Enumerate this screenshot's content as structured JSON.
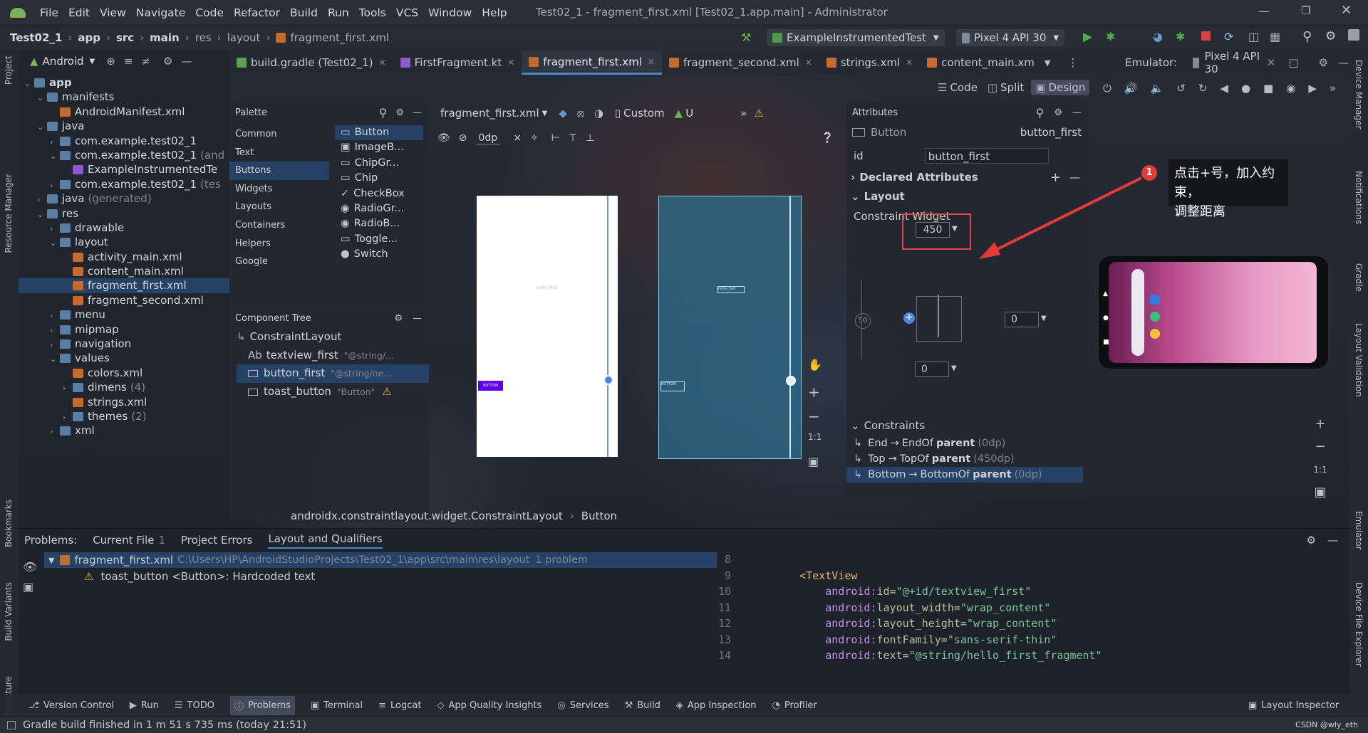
{
  "menu": [
    "File",
    "Edit",
    "View",
    "Navigate",
    "Code",
    "Refactor",
    "Build",
    "Run",
    "Tools",
    "VCS",
    "Window",
    "Help"
  ],
  "window_title": "Test02_1 - fragment_first.xml [Test02_1.app.main] - Administrator",
  "breadcrumb": [
    "Test02_1",
    "app",
    "src",
    "main",
    "res",
    "layout",
    "fragment_first.xml"
  ],
  "run_config": "ExampleInstrumentedTest",
  "device": "Pixel 4 API 30",
  "project_view": "Android",
  "editor_tabs": [
    "build.gradle (Test02_1)",
    "FirstFragment.kt",
    "fragment_first.xml",
    "fragment_second.xml",
    "strings.xml",
    "content_main.xm"
  ],
  "emulator": {
    "label": "Emulator:",
    "device": "Pixel 4 API 30"
  },
  "view_modes": [
    "Code",
    "Split",
    "Design"
  ],
  "tree": [
    {
      "label": "app",
      "depth": 0,
      "arrow": "v",
      "bold": true
    },
    {
      "label": "manifests",
      "depth": 1,
      "arrow": "v"
    },
    {
      "label": "AndroidManifest.xml",
      "depth": 2,
      "arrow": ""
    },
    {
      "label": "java",
      "depth": 1,
      "arrow": "v"
    },
    {
      "label": "com.example.test02_1",
      "depth": 2,
      "arrow": ">"
    },
    {
      "label": "com.example.test02_1",
      "suffix": "(and",
      "depth": 2,
      "arrow": "v"
    },
    {
      "label": "ExampleInstrumentedTe",
      "depth": 3,
      "arrow": ""
    },
    {
      "label": "com.example.test02_1",
      "suffix": "(tes",
      "depth": 2,
      "arrow": ">"
    },
    {
      "label": "java",
      "suffix": "(generated)",
      "depth": 1,
      "arrow": ">"
    },
    {
      "label": "res",
      "depth": 1,
      "arrow": "v"
    },
    {
      "label": "drawable",
      "depth": 2,
      "arrow": ">"
    },
    {
      "label": "layout",
      "depth": 2,
      "arrow": "v"
    },
    {
      "label": "activity_main.xml",
      "depth": 3,
      "arrow": ""
    },
    {
      "label": "content_main.xml",
      "depth": 3,
      "arrow": ""
    },
    {
      "label": "fragment_first.xml",
      "depth": 3,
      "arrow": "",
      "sel": true
    },
    {
      "label": "fragment_second.xml",
      "depth": 3,
      "arrow": ""
    },
    {
      "label": "menu",
      "depth": 2,
      "arrow": ">"
    },
    {
      "label": "mipmap",
      "depth": 2,
      "arrow": ">"
    },
    {
      "label": "navigation",
      "depth": 2,
      "arrow": ">"
    },
    {
      "label": "values",
      "depth": 2,
      "arrow": "v"
    },
    {
      "label": "colors.xml",
      "depth": 3,
      "arrow": ""
    },
    {
      "label": "dimens",
      "suffix": "(4)",
      "depth": 3,
      "arrow": ">"
    },
    {
      "label": "strings.xml",
      "depth": 3,
      "arrow": ""
    },
    {
      "label": "themes",
      "suffix": "(2)",
      "depth": 3,
      "arrow": ">"
    },
    {
      "label": "xml",
      "depth": 2,
      "arrow": ">"
    }
  ],
  "palette": {
    "title": "Palette",
    "categories": [
      "Common",
      "Text",
      "Buttons",
      "Widgets",
      "Layouts",
      "Containers",
      "Helpers",
      "Google"
    ],
    "items": [
      "Button",
      "ImageB...",
      "ChipGr...",
      "Chip",
      "CheckBox",
      "RadioGr...",
      "RadioB...",
      "Toggle...",
      "Switch"
    ]
  },
  "component_tree": {
    "title": "Component Tree",
    "root": "ConstraintLayout",
    "children": [
      {
        "label": "textview_first",
        "hint": "\"@string/...",
        "prefix": "Ab"
      },
      {
        "label": "button_first",
        "hint": "\"@string/ne...",
        "sel": true
      },
      {
        "label": "toast_button",
        "hint": "\"Button\""
      }
    ]
  },
  "design_toolbar": {
    "file": "fragment_first.xml",
    "device": "Custom",
    "api": "U",
    "margin": "0dp"
  },
  "design_breadcrumb": [
    "androidx.constraintlayout.widget.ConstraintLayout",
    "Button"
  ],
  "attributes": {
    "title": "Attributes",
    "widget_type": "Button",
    "widget_id": "button_first",
    "id_label": "id",
    "id_value": "button_first",
    "declared": "Declared Attributes",
    "layout": "Layout",
    "constraint_widget": "Constraint Widget",
    "top_margin": "450",
    "right_margin": "0",
    "bottom_margin": "0",
    "left_bias": "50",
    "constraints_title": "Constraints",
    "constraints": [
      {
        "a": "End",
        "b": "EndOf",
        "c": "parent",
        "d": "(0dp)"
      },
      {
        "a": "Top",
        "b": "TopOf",
        "c": "parent",
        "d": "(450dp)"
      },
      {
        "a": "Bottom",
        "b": "BottomOf",
        "c": "parent",
        "d": "(0dp)",
        "sel": true
      }
    ]
  },
  "annotation": {
    "number": "1",
    "text_line1": "点击+号，加入约束，",
    "text_line2": "调整距离"
  },
  "problems": {
    "tabs": [
      "Problems:",
      "Current File",
      "1",
      "Project Errors",
      "Layout and Qualifiers"
    ],
    "file": "fragment_first.xml",
    "path": "C:\\Users\\HP\\AndroidStudioProjects\\Test02_1\\app\\src\\main\\res\\layout",
    "count": "1 problem",
    "issue": "toast_button <Button>: Hardcoded text"
  },
  "code": {
    "line_numbers": [
      "8",
      "9",
      "10",
      "11",
      "12",
      "13",
      "14"
    ],
    "lines": [
      {
        "indent": "",
        "tag": "",
        "attr": "",
        "val": ""
      },
      {
        "indent": "    ",
        "tag": "<TextView",
        "attr": "",
        "val": ""
      },
      {
        "indent": "        ",
        "ns": "android:",
        "attr": "id=",
        "val": "\"@+id/textview_first\""
      },
      {
        "indent": "        ",
        "ns": "android:",
        "attr": "layout_width=",
        "val": "\"wrap_content\""
      },
      {
        "indent": "        ",
        "ns": "android:",
        "attr": "layout_height=",
        "val": "\"wrap_content\""
      },
      {
        "indent": "        ",
        "ns": "android:",
        "attr": "fontFamily=",
        "val": "\"sans-serif-thin\""
      },
      {
        "indent": "        ",
        "ns": "android:",
        "attr": "text=",
        "val": "\"@string/hello_first_fragment\""
      }
    ]
  },
  "bottom_tabs": [
    "Version Control",
    "Run",
    "TODO",
    "Problems",
    "Terminal",
    "Logcat",
    "App Quality Insights",
    "Services",
    "Build",
    "App Inspection",
    "Profiler"
  ],
  "layout_inspector": "Layout Inspector",
  "status": "Gradle build finished in 1 m 51 s 735 ms (today 21:51)",
  "watermark": "CSDN @wly_eth",
  "left_strip": [
    "Project",
    "Resource Manager",
    "Bookmarks",
    "Build Variants",
    "Structure"
  ],
  "right_strip": [
    "Device Manager",
    "Notifications",
    "Gradle",
    "Layout Validation",
    "Emulator",
    "Device File Explorer"
  ],
  "preview_button_text": "BUTTON"
}
